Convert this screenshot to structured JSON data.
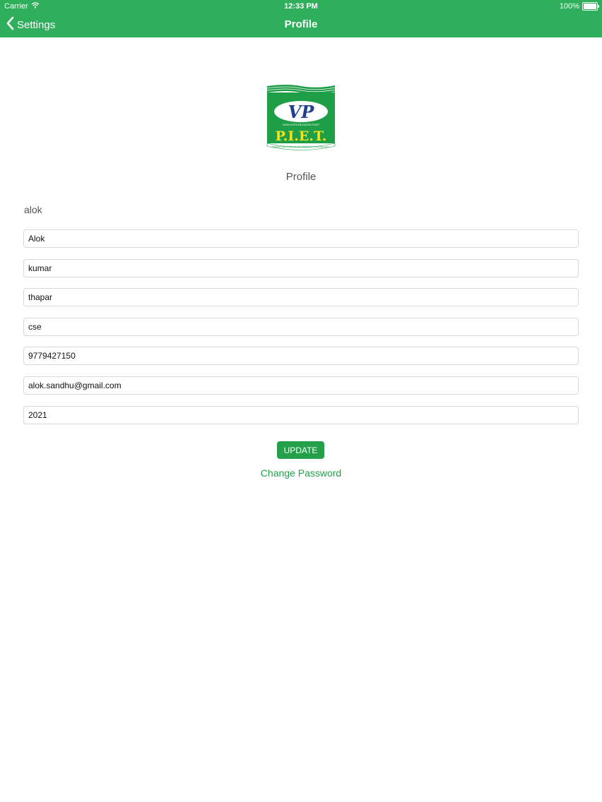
{
  "status_bar": {
    "carrier": "Carrier",
    "time": "12:33 PM",
    "battery": "100%"
  },
  "nav": {
    "back_label": "Settings",
    "title": "Profile"
  },
  "logo": {
    "text": "P.I.E.T.",
    "monogram": "VP",
    "arc_top": "VIDYA JYOTHI EDUCATION TRUST",
    "arc_bottom": "PANIPAT INSTITUTE OF ENGINEERING & TECHNOLOGY"
  },
  "profile": {
    "caption": "Profile",
    "username": "alok",
    "fields": [
      {
        "value": "Alok"
      },
      {
        "value": "kumar"
      },
      {
        "value": "thapar"
      },
      {
        "value": "cse"
      },
      {
        "value": "9779427150"
      },
      {
        "value": "alok.sandhu@gmail.com"
      },
      {
        "value": "2021"
      }
    ],
    "update_label": "UPDATE",
    "change_password_label": "Change Password"
  },
  "colors": {
    "header": "#2fae5b",
    "accent": "#24a04a",
    "logo_green": "#1e9e46",
    "logo_blue": "#1f3f8f",
    "logo_yellow": "#f4e31c"
  }
}
